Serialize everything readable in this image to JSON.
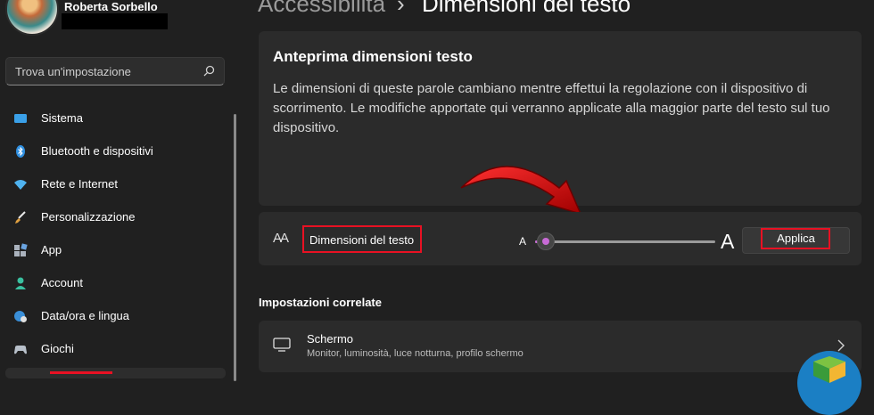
{
  "user": {
    "name": "Roberta Sorbello"
  },
  "search": {
    "placeholder": "Trova un'impostazione"
  },
  "sidebar": {
    "items": [
      {
        "label": "Sistema",
        "icon": "display-icon"
      },
      {
        "label": "Bluetooth e dispositivi",
        "icon": "bluetooth-icon"
      },
      {
        "label": "Rete e Internet",
        "icon": "wifi-icon"
      },
      {
        "label": "Personalizzazione",
        "icon": "brush-icon"
      },
      {
        "label": "App",
        "icon": "apps-icon"
      },
      {
        "label": "Account",
        "icon": "person-icon"
      },
      {
        "label": "Data/ora e lingua",
        "icon": "globe-clock-icon"
      },
      {
        "label": "Giochi",
        "icon": "gamepad-icon"
      }
    ]
  },
  "breadcrumb": {
    "parent": "Accessibilità",
    "separator": "›",
    "current": "Dimensioni del testo"
  },
  "preview": {
    "title": "Anteprima dimensioni testo",
    "text": "Le dimensioni di queste parole cambiano mentre effettui la regolazione con il dispositivo di scorrimento. Le modifiche apportate qui verranno applicate alla maggior parte del testo sul tuo dispositivo."
  },
  "text_size": {
    "icon_glyph": "AA",
    "label": "Dimensioni del testo",
    "slider_min_label": "A",
    "slider_max_label": "A",
    "slider_value_fraction": 0.06,
    "apply_label": "Applica"
  },
  "related": {
    "heading": "Impostazioni correlate",
    "display": {
      "title": "Schermo",
      "subtitle": "Monitor, luminosità, luce notturna, profilo schermo"
    }
  },
  "colors": {
    "accent": "#c86bd6",
    "highlight": "#e81123",
    "background": "#202020",
    "card": "#2b2b2b"
  }
}
